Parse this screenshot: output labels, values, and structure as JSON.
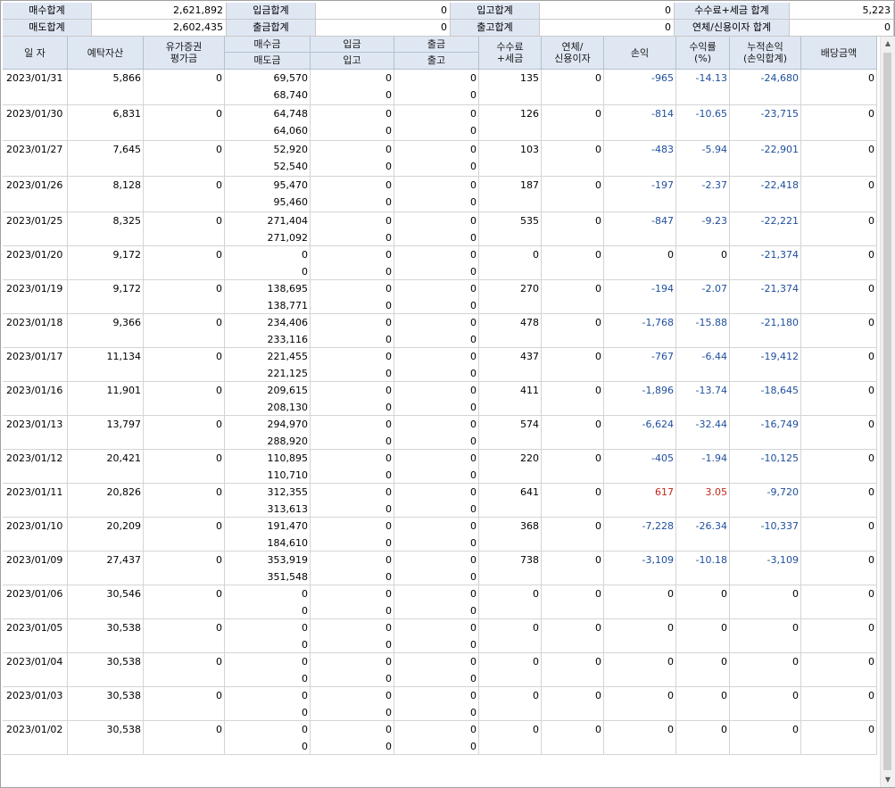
{
  "summary": {
    "row1": [
      {
        "label": "매수합계",
        "value": "2,621,892"
      },
      {
        "label": "입금합계",
        "value": "0"
      },
      {
        "label": "입고합계",
        "value": "0"
      },
      {
        "label": "수수료+세금 합계",
        "value": "5,223"
      }
    ],
    "row2": [
      {
        "label": "매도합계",
        "value": "2,602,435"
      },
      {
        "label": "출금합계",
        "value": "0"
      },
      {
        "label": "출고합계",
        "value": "0"
      },
      {
        "label": "연체/신용이자 합계",
        "value": "0"
      }
    ]
  },
  "headers": {
    "date": "일 자",
    "deposit": "예탁자산",
    "securities": [
      "유가증권",
      "평가금"
    ],
    "buy": "매수금",
    "sell": "매도금",
    "in_money": "입금",
    "in_stock": "입고",
    "out_money": "출금",
    "out_stock": "출고",
    "fee": [
      "수수료",
      "+세금"
    ],
    "interest": [
      "연체/",
      "신용이자"
    ],
    "pnl": "손익",
    "rate": [
      "수익률",
      "(%)"
    ],
    "cum": [
      "누적손익",
      "(손익합계)"
    ],
    "dividend": "배당금액"
  },
  "rows": [
    {
      "date": "2023/01/31",
      "deposit": "5,866",
      "securities": "0",
      "buy": "69,570",
      "sell": "68,740",
      "in_money": "0",
      "in_stock": "0",
      "out_money": "0",
      "out_stock": "0",
      "fee": "135",
      "interest": "0",
      "pnl": "-965",
      "rate": "-14.13",
      "cum": "-24,680",
      "dividend": "0"
    },
    {
      "date": "2023/01/30",
      "deposit": "6,831",
      "securities": "0",
      "buy": "64,748",
      "sell": "64,060",
      "in_money": "0",
      "in_stock": "0",
      "out_money": "0",
      "out_stock": "0",
      "fee": "126",
      "interest": "0",
      "pnl": "-814",
      "rate": "-10.65",
      "cum": "-23,715",
      "dividend": "0"
    },
    {
      "date": "2023/01/27",
      "deposit": "7,645",
      "securities": "0",
      "buy": "52,920",
      "sell": "52,540",
      "in_money": "0",
      "in_stock": "0",
      "out_money": "0",
      "out_stock": "0",
      "fee": "103",
      "interest": "0",
      "pnl": "-483",
      "rate": "-5.94",
      "cum": "-22,901",
      "dividend": "0"
    },
    {
      "date": "2023/01/26",
      "deposit": "8,128",
      "securities": "0",
      "buy": "95,470",
      "sell": "95,460",
      "in_money": "0",
      "in_stock": "0",
      "out_money": "0",
      "out_stock": "0",
      "fee": "187",
      "interest": "0",
      "pnl": "-197",
      "rate": "-2.37",
      "cum": "-22,418",
      "dividend": "0"
    },
    {
      "date": "2023/01/25",
      "deposit": "8,325",
      "securities": "0",
      "buy": "271,404",
      "sell": "271,092",
      "in_money": "0",
      "in_stock": "0",
      "out_money": "0",
      "out_stock": "0",
      "fee": "535",
      "interest": "0",
      "pnl": "-847",
      "rate": "-9.23",
      "cum": "-22,221",
      "dividend": "0"
    },
    {
      "date": "2023/01/20",
      "deposit": "9,172",
      "securities": "0",
      "buy": "0",
      "sell": "0",
      "in_money": "0",
      "in_stock": "0",
      "out_money": "0",
      "out_stock": "0",
      "fee": "0",
      "interest": "0",
      "pnl": "0",
      "rate": "0",
      "cum": "-21,374",
      "dividend": "0"
    },
    {
      "date": "2023/01/19",
      "deposit": "9,172",
      "securities": "0",
      "buy": "138,695",
      "sell": "138,771",
      "in_money": "0",
      "in_stock": "0",
      "out_money": "0",
      "out_stock": "0",
      "fee": "270",
      "interest": "0",
      "pnl": "-194",
      "rate": "-2.07",
      "cum": "-21,374",
      "dividend": "0"
    },
    {
      "date": "2023/01/18",
      "deposit": "9,366",
      "securities": "0",
      "buy": "234,406",
      "sell": "233,116",
      "in_money": "0",
      "in_stock": "0",
      "out_money": "0",
      "out_stock": "0",
      "fee": "478",
      "interest": "0",
      "pnl": "-1,768",
      "rate": "-15.88",
      "cum": "-21,180",
      "dividend": "0"
    },
    {
      "date": "2023/01/17",
      "deposit": "11,134",
      "securities": "0",
      "buy": "221,455",
      "sell": "221,125",
      "in_money": "0",
      "in_stock": "0",
      "out_money": "0",
      "out_stock": "0",
      "fee": "437",
      "interest": "0",
      "pnl": "-767",
      "rate": "-6.44",
      "cum": "-19,412",
      "dividend": "0"
    },
    {
      "date": "2023/01/16",
      "deposit": "11,901",
      "securities": "0",
      "buy": "209,615",
      "sell": "208,130",
      "in_money": "0",
      "in_stock": "0",
      "out_money": "0",
      "out_stock": "0",
      "fee": "411",
      "interest": "0",
      "pnl": "-1,896",
      "rate": "-13.74",
      "cum": "-18,645",
      "dividend": "0"
    },
    {
      "date": "2023/01/13",
      "deposit": "13,797",
      "securities": "0",
      "buy": "294,970",
      "sell": "288,920",
      "in_money": "0",
      "in_stock": "0",
      "out_money": "0",
      "out_stock": "0",
      "fee": "574",
      "interest": "0",
      "pnl": "-6,624",
      "rate": "-32.44",
      "cum": "-16,749",
      "dividend": "0"
    },
    {
      "date": "2023/01/12",
      "deposit": "20,421",
      "securities": "0",
      "buy": "110,895",
      "sell": "110,710",
      "in_money": "0",
      "in_stock": "0",
      "out_money": "0",
      "out_stock": "0",
      "fee": "220",
      "interest": "0",
      "pnl": "-405",
      "rate": "-1.94",
      "cum": "-10,125",
      "dividend": "0"
    },
    {
      "date": "2023/01/11",
      "deposit": "20,826",
      "securities": "0",
      "buy": "312,355",
      "sell": "313,613",
      "in_money": "0",
      "in_stock": "0",
      "out_money": "0",
      "out_stock": "0",
      "fee": "641",
      "interest": "0",
      "pnl": "617",
      "rate": "3.05",
      "cum": "-9,720",
      "dividend": "0"
    },
    {
      "date": "2023/01/10",
      "deposit": "20,209",
      "securities": "0",
      "buy": "191,470",
      "sell": "184,610",
      "in_money": "0",
      "in_stock": "0",
      "out_money": "0",
      "out_stock": "0",
      "fee": "368",
      "interest": "0",
      "pnl": "-7,228",
      "rate": "-26.34",
      "cum": "-10,337",
      "dividend": "0"
    },
    {
      "date": "2023/01/09",
      "deposit": "27,437",
      "securities": "0",
      "buy": "353,919",
      "sell": "351,548",
      "in_money": "0",
      "in_stock": "0",
      "out_money": "0",
      "out_stock": "0",
      "fee": "738",
      "interest": "0",
      "pnl": "-3,109",
      "rate": "-10.18",
      "cum": "-3,109",
      "dividend": "0"
    },
    {
      "date": "2023/01/06",
      "deposit": "30,546",
      "securities": "0",
      "buy": "0",
      "sell": "0",
      "in_money": "0",
      "in_stock": "0",
      "out_money": "0",
      "out_stock": "0",
      "fee": "0",
      "interest": "0",
      "pnl": "0",
      "rate": "0",
      "cum": "0",
      "dividend": "0"
    },
    {
      "date": "2023/01/05",
      "deposit": "30,538",
      "securities": "0",
      "buy": "0",
      "sell": "0",
      "in_money": "0",
      "in_stock": "0",
      "out_money": "0",
      "out_stock": "0",
      "fee": "0",
      "interest": "0",
      "pnl": "0",
      "rate": "0",
      "cum": "0",
      "dividend": "0"
    },
    {
      "date": "2023/01/04",
      "deposit": "30,538",
      "securities": "0",
      "buy": "0",
      "sell": "0",
      "in_money": "0",
      "in_stock": "0",
      "out_money": "0",
      "out_stock": "0",
      "fee": "0",
      "interest": "0",
      "pnl": "0",
      "rate": "0",
      "cum": "0",
      "dividend": "0"
    },
    {
      "date": "2023/01/03",
      "deposit": "30,538",
      "securities": "0",
      "buy": "0",
      "sell": "0",
      "in_money": "0",
      "in_stock": "0",
      "out_money": "0",
      "out_stock": "0",
      "fee": "0",
      "interest": "0",
      "pnl": "0",
      "rate": "0",
      "cum": "0",
      "dividend": "0"
    },
    {
      "date": "2023/01/02",
      "deposit": "30,538",
      "securities": "0",
      "buy": "0",
      "sell": "0",
      "in_money": "0",
      "in_stock": "0",
      "out_money": "0",
      "out_stock": "0",
      "fee": "0",
      "interest": "0",
      "pnl": "0",
      "rate": "0",
      "cum": "0",
      "dividend": "0"
    }
  ],
  "colors": {
    "header_bg": "#dfe7f3",
    "negative": "#1e4e9c",
    "positive": "#c4261a"
  },
  "icons": {
    "scroll_up": "scroll-up-arrow-icon",
    "scroll_down": "scroll-down-arrow-icon"
  }
}
